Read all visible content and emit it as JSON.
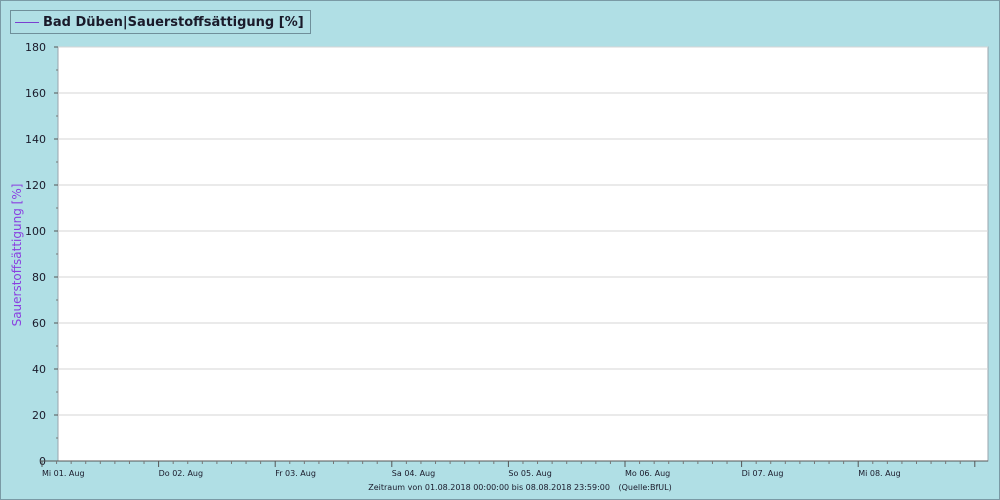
{
  "chart_data": {
    "type": "line",
    "legend": "Bad Düben|Sauerstoffsättigung [%]",
    "series": [
      {
        "name": "Bad Düben|Sauerstoffsättigung [%]",
        "color": "#7a3fd0",
        "values": []
      }
    ],
    "ylabel": "Sauerstoffsättigung [%]",
    "ylim": [
      0,
      180
    ],
    "yticks": [
      0,
      20,
      40,
      60,
      80,
      100,
      120,
      140,
      160,
      180
    ],
    "xlabels": [
      "Mi 01. Aug",
      "Do 02. Aug",
      "Fr 03. Aug",
      "Sa 04. Aug",
      "So 05. Aug",
      "Mo 06. Aug",
      "Di 07. Aug",
      "Mi 08. Aug"
    ],
    "xlim": [
      "01.08.2018 00:00",
      "09.08.2018 00:00"
    ],
    "grid": true,
    "legend_position": "top-left"
  },
  "footer": {
    "range_label": "Zeitraum  von 01.08.2018  00:00:00  bis  08.08.2018  23:59:00",
    "source": "(Quelle:BfUL)"
  }
}
